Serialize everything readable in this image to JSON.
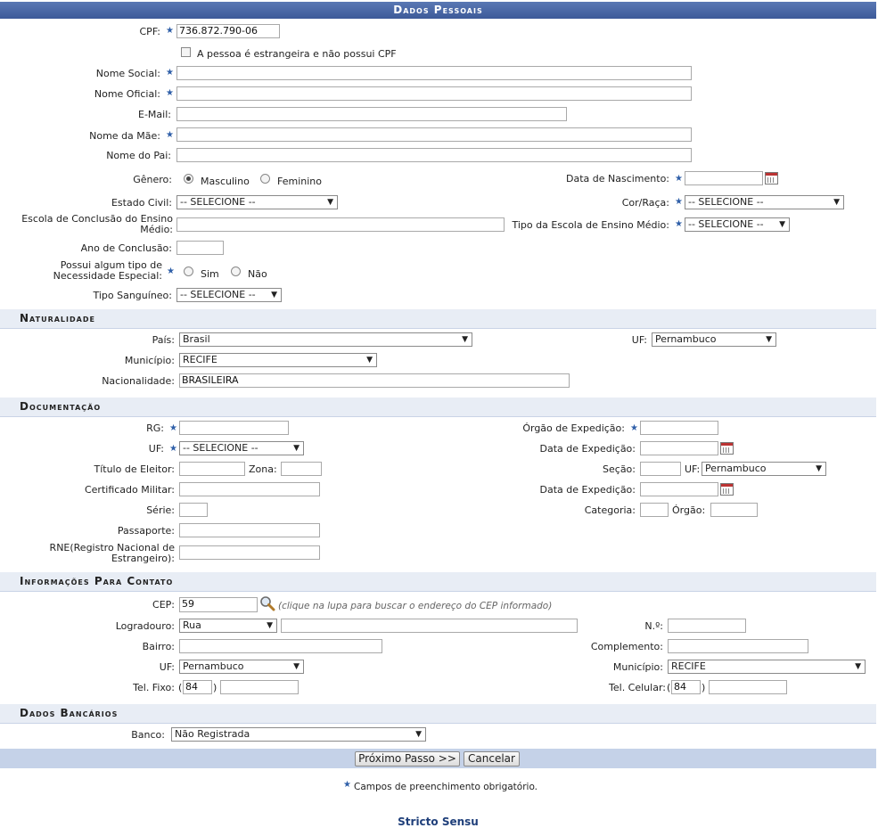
{
  "title": "Dados Pessoais",
  "dados": {
    "cpf_label": "CPF:",
    "cpf_value": "736.872.790-06",
    "estrangeiro_label": "A pessoa é estrangeira e não possui CPF",
    "nome_social_label": "Nome Social:",
    "nome_oficial_label": "Nome Oficial:",
    "email_label": "E-Mail:",
    "nome_mae_label": "Nome da Mãe:",
    "nome_pai_label": "Nome do Pai:",
    "genero_label": "Gênero:",
    "masculino": "Masculino",
    "feminino": "Feminino",
    "data_nasc_label": "Data de Nascimento:",
    "estado_civil_label": "Estado Civil:",
    "estado_civil_value": "-- SELECIONE --",
    "cor_label": "Cor/Raça:",
    "cor_value": "-- SELECIONE --",
    "escola_label": "Escola de Conclusão do Ensino Médio:",
    "tipo_escola_label": "Tipo da Escola de Ensino Médio:",
    "tipo_escola_value": "-- SELECIONE --",
    "ano_label": "Ano de Conclusão:",
    "necessidade_label": "Possui algum tipo de Necessidade Especial:",
    "sim": "Sim",
    "nao": "Não",
    "sangue_label": "Tipo Sanguíneo:",
    "sangue_value": "-- SELECIONE --"
  },
  "naturalidade": {
    "title": "Naturalidade",
    "pais_label": "País:",
    "pais_value": "Brasil",
    "uf_label": "UF:",
    "uf_value": "Pernambuco",
    "municipio_label": "Município:",
    "municipio_value": "RECIFE",
    "nacionalidade_label": "Nacionalidade:",
    "nacionalidade_value": "BRASILEIRA"
  },
  "documentacao": {
    "title": "Documentação",
    "rg_label": "RG:",
    "orgao_label": "Órgão de Expedição:",
    "uf_label": "UF:",
    "uf_value": "-- SELECIONE --",
    "data_exp_label": "Data de Expedição:",
    "titulo_label": "Título de Eleitor:",
    "zona_label": "Zona:",
    "secao_label": "Seção:",
    "uf2_label": "UF:",
    "uf2_value": "Pernambuco",
    "cert_label": "Certificado Militar:",
    "data_exp2_label": "Data de Expedição:",
    "serie_label": "Série:",
    "categoria_label": "Categoria:",
    "orgao2_label": "Órgão:",
    "passaporte_label": "Passaporte:",
    "rne_label": "RNE(Registro Nacional de Estrangeiro):"
  },
  "contato": {
    "title": "Informações Para Contato",
    "cep_label": "CEP:",
    "cep_value": "59",
    "cep_hint": "(clique na lupa para buscar o endereço do CEP informado)",
    "logradouro_label": "Logradouro:",
    "logradouro_value": "Rua",
    "numero_label": "N.º:",
    "bairro_label": "Bairro:",
    "complemento_label": "Complemento:",
    "uf_label": "UF:",
    "uf_value": "Pernambuco",
    "municipio_label": "Município:",
    "municipio_value": "RECIFE",
    "tel_fixo_label": "Tel. Fixo:",
    "tel_celular_label": "Tel. Celular:",
    "ddd_fixo": "84",
    "ddd_celular": "84",
    "paren_open": "(",
    "paren_close": ")"
  },
  "bancarios": {
    "title": "Dados Bancários",
    "banco_label": "Banco:",
    "banco_value": "Não Registrada"
  },
  "buttons": {
    "next": "Próximo Passo >>",
    "cancel": "Cancelar"
  },
  "footer": {
    "required_note": "Campos de preenchimento obrigatório.",
    "link": "Stricto Sensu"
  },
  "colors": {
    "title_bar": "#4a68a8",
    "section_bg": "#e8edf5",
    "required_star": "#2f5fa8",
    "footer_link": "#1f3f7a"
  }
}
